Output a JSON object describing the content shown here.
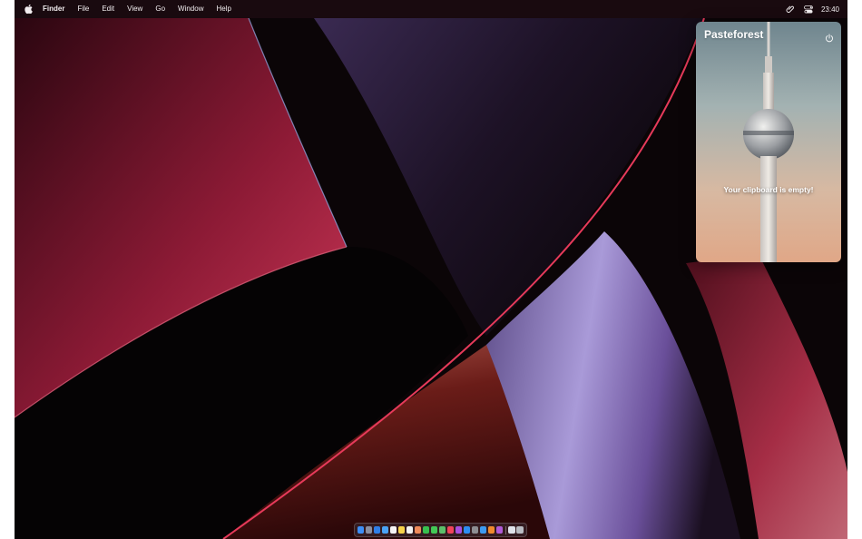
{
  "menubar": {
    "app_name": "Finder",
    "menus": [
      "File",
      "Edit",
      "View",
      "Go",
      "Window",
      "Help"
    ],
    "status_icons": [
      "paperclip-icon",
      "control-center-icon"
    ],
    "clock": "23:40"
  },
  "popover": {
    "title": "Pasteforest",
    "empty_message": "Your clipboard is empty!",
    "power_icon": "power-icon"
  },
  "dock": {
    "apps": [
      {
        "name": "finder",
        "color": "#3d8ef5"
      },
      {
        "name": "launchpad",
        "color": "#8a8fa0"
      },
      {
        "name": "safari",
        "color": "#2f7fe8"
      },
      {
        "name": "mail",
        "color": "#4aa3f5"
      },
      {
        "name": "calendar",
        "color": "#f4f4f4"
      },
      {
        "name": "notes",
        "color": "#f7d34a"
      },
      {
        "name": "reminders",
        "color": "#f2f2f2"
      },
      {
        "name": "photos",
        "color": "#f08a5a"
      },
      {
        "name": "facetime",
        "color": "#38c04f"
      },
      {
        "name": "messages",
        "color": "#43c856"
      },
      {
        "name": "maps",
        "color": "#5bbf6a"
      },
      {
        "name": "music",
        "color": "#f2435b"
      },
      {
        "name": "podcasts",
        "color": "#a84fe0"
      },
      {
        "name": "app-store",
        "color": "#2d8ef2"
      },
      {
        "name": "system-preferences",
        "color": "#8d8d92"
      },
      {
        "name": "xcode",
        "color": "#3d9af0"
      },
      {
        "name": "pages",
        "color": "#ef8a2d"
      },
      {
        "name": "pasteforest",
        "color": "#b05ad8"
      }
    ],
    "extras": [
      {
        "name": "downloads-stack",
        "color": "#dfe3ea"
      },
      {
        "name": "trash",
        "color": "#b9bcc2"
      }
    ]
  }
}
